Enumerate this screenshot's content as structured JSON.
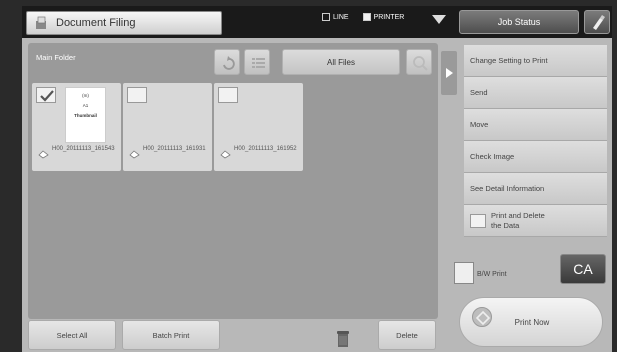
{
  "header": {
    "title": "Document Filing",
    "modes": [
      {
        "label": "LINE",
        "checked": false
      },
      {
        "label": "PRINTER",
        "checked": true
      }
    ],
    "job_status": "Job Status"
  },
  "folder": {
    "label": "Main Folder",
    "filter": "All Files"
  },
  "files": [
    {
      "name": "H00_20111113_161543",
      "checked": true,
      "thumb_lines": [
        "(m)",
        "A1",
        "Thumbnail"
      ]
    },
    {
      "name": "H00_20111113_161931",
      "checked": false,
      "thumb_lines": []
    },
    {
      "name": "H00_20111113_161952",
      "checked": false,
      "thumb_lines": []
    }
  ],
  "bottom": {
    "select_all": "Select All",
    "batch_print": "Batch Print",
    "delete": "Delete"
  },
  "actions": [
    "Change Setting to Print",
    "Send",
    "Move",
    "Check Image",
    "See Detail Information"
  ],
  "print_and_delete": [
    "Print and Delete",
    "the Data"
  ],
  "bw_print": "B/W Print",
  "ca": "CA",
  "print_now": "Print Now",
  "colors": {
    "frame": "#b8b8b8",
    "topbar": "#1a1a1a",
    "panel": "#9a9a9a"
  }
}
